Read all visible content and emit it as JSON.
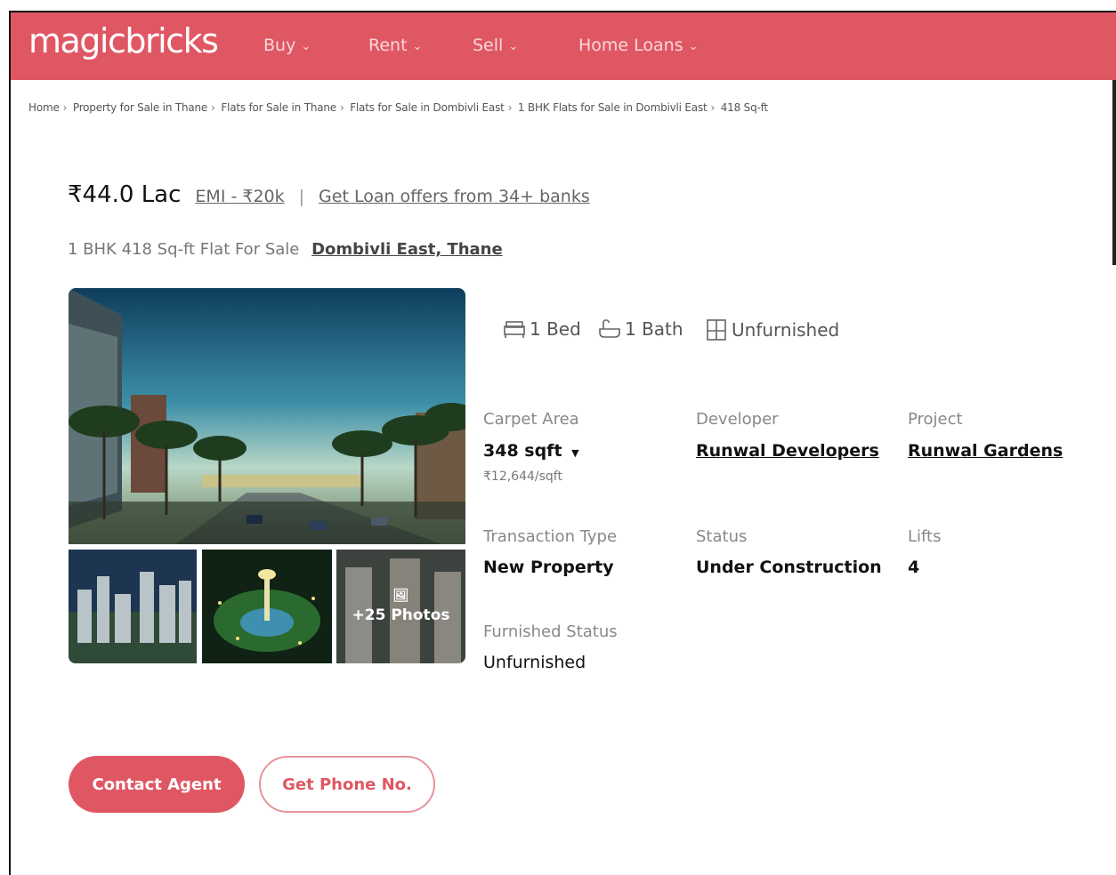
{
  "header": {
    "logo": "magicbricks",
    "nav": [
      {
        "label": "Buy"
      },
      {
        "label": "Rent"
      },
      {
        "label": "Sell"
      },
      {
        "label": "Home Loans"
      }
    ],
    "brand_color": "#e05764"
  },
  "breadcrumb": [
    "Home",
    "Property for Sale in Thane",
    "Flats for Sale in Thane",
    "Flats for Sale in Dombivli East",
    "1 BHK Flats for Sale in Dombivli East",
    "418 Sq-ft"
  ],
  "listing": {
    "price": "₹44.0 Lac",
    "emi": "EMI - ₹20k",
    "loan_offer": "Get Loan offers from 34+ banks",
    "title": "1 BHK 418 Sq-ft Flat For Sale",
    "location": "Dombivli East, Thane",
    "photos_more": "+25 Photos"
  },
  "features": {
    "bed": "1 Bed",
    "bath": "1 Bath",
    "furnishing": "Unfurnished"
  },
  "details": {
    "carpet_area_label": "Carpet Area",
    "carpet_area_value": "348 sqft",
    "price_per_sqft": "₹12,644/sqft",
    "developer_label": "Developer",
    "developer_value": "Runwal Developers",
    "project_label": "Project",
    "project_value": "Runwal Gardens",
    "transaction_label": "Transaction Type",
    "transaction_value": "New Property",
    "status_label": "Status",
    "status_value": "Under Construction",
    "lifts_label": "Lifts",
    "lifts_value": "4",
    "furnished_label": "Furnished Status",
    "furnished_value": "Unfurnished"
  },
  "actions": {
    "contact_agent": "Contact Agent",
    "get_phone": "Get Phone No."
  }
}
